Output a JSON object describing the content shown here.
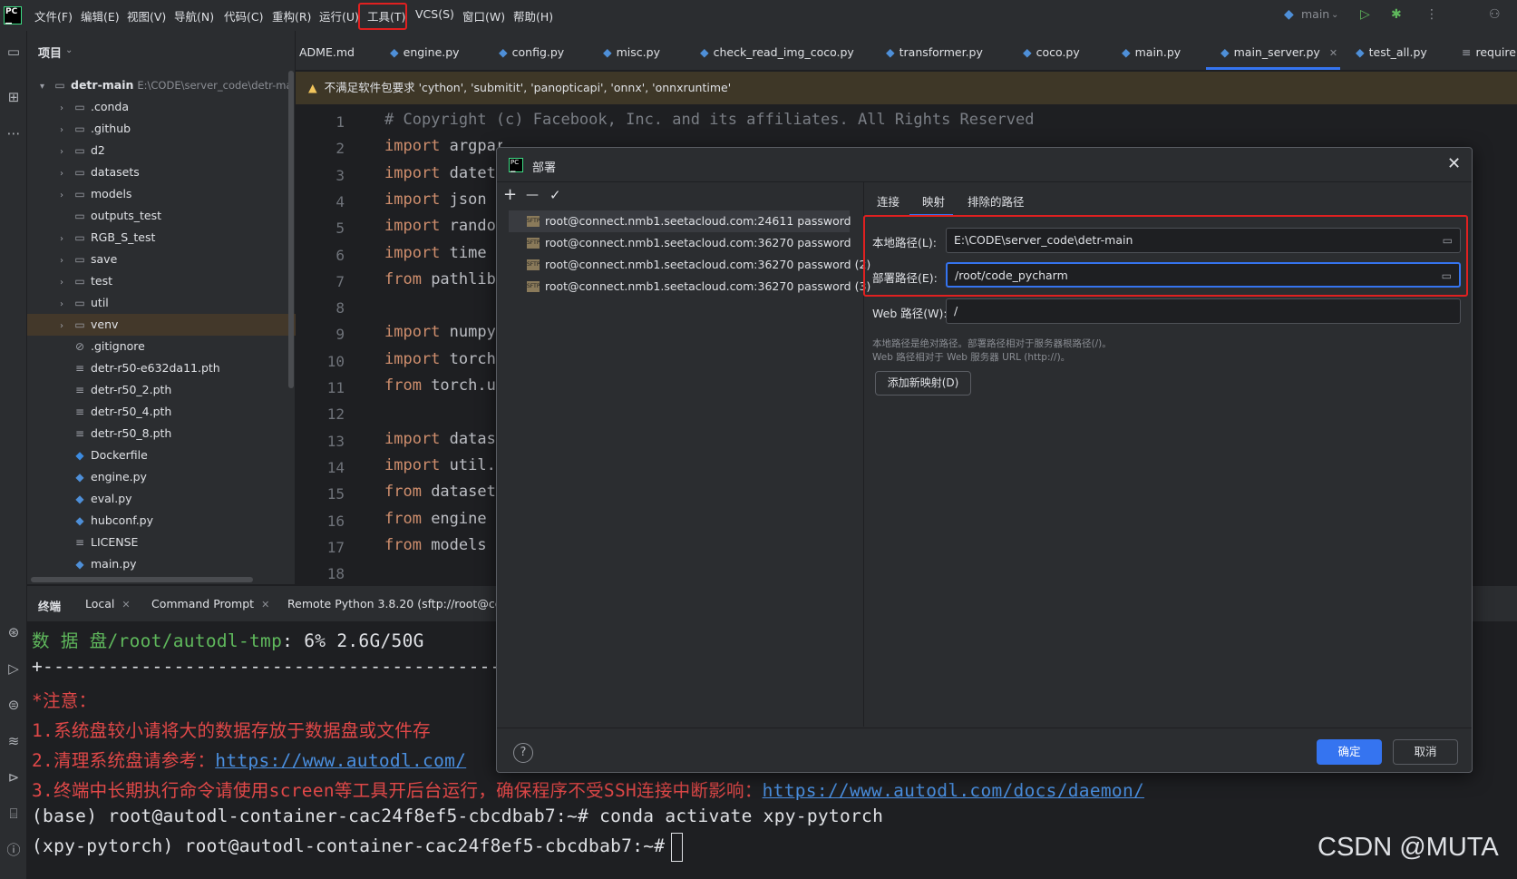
{
  "menubar": {
    "items": [
      "文件(F)",
      "编辑(E)",
      "视图(V)",
      "导航(N)",
      "代码(C)",
      "重构(R)",
      "运行(U)",
      "工具(T)",
      "VCS(S)",
      "窗口(W)",
      "帮助(H)"
    ],
    "branch": "main"
  },
  "project": {
    "title": "项目",
    "root": {
      "name": "detr-main",
      "path": "E:\\CODE\\server_code\\detr-ma"
    },
    "items": [
      ".conda",
      ".github",
      "d2",
      "datasets",
      "models",
      "outputs_test",
      "RGB_S_test",
      "save",
      "test",
      "util",
      "venv",
      ".gitignore",
      "detr-r50-e632da11.pth",
      "detr-r50_2.pth",
      "detr-r50_4.pth",
      "detr-r50_8.pth",
      "Dockerfile",
      "engine.py",
      "eval.py",
      "hubconf.py",
      "LICENSE",
      "main.py"
    ]
  },
  "tabs": [
    "ADME.md",
    "engine.py",
    "config.py",
    "misc.py",
    "check_read_img_coco.py",
    "transformer.py",
    "coco.py",
    "main.py",
    "main_server.py",
    "test_all.py",
    "require"
  ],
  "warning": "不满足软件包要求 'cython', 'submitit', 'panopticapi', 'onnx', 'onnxruntime'",
  "editor": {
    "line_numbers": [
      "1",
      "2",
      "3",
      "4",
      "5",
      "6",
      "7",
      "8",
      "9",
      "10",
      "11",
      "12",
      "13",
      "14",
      "15",
      "16",
      "17",
      "18"
    ],
    "lines": [
      {
        "kw": "",
        "rest": "# Copyright (c) Facebook, Inc. and its affiliates. All Rights Reserved"
      },
      {
        "kw": "import",
        "rest": " argparse"
      },
      {
        "kw": "import",
        "rest": " dateti"
      },
      {
        "kw": "import",
        "rest": " json"
      },
      {
        "kw": "import",
        "rest": " randon"
      },
      {
        "kw": "import",
        "rest": " time"
      },
      {
        "kw": "from",
        "rest": " pathlib"
      },
      {
        "kw": "",
        "rest": ""
      },
      {
        "kw": "import",
        "rest": " numpy"
      },
      {
        "kw": "import",
        "rest": " torch"
      },
      {
        "kw": "from",
        "rest": " torch.ut"
      },
      {
        "kw": "",
        "rest": ""
      },
      {
        "kw": "import",
        "rest": " datase"
      },
      {
        "kw": "import",
        "rest": " util.r"
      },
      {
        "kw": "from",
        "rest": " datasets"
      },
      {
        "kw": "from",
        "rest": " engine i"
      },
      {
        "kw": "from",
        "rest": " models i"
      },
      {
        "kw": "",
        "rest": ""
      }
    ]
  },
  "terminal_tabs": [
    "终端",
    "Local",
    "Command Prompt",
    "Remote Python 3.8.20 (sftp://root@conn"
  ],
  "terminal": {
    "line1_label": "数 据 盘",
    "line1_path": "/root/autodl-tmp",
    "line1_rest": ": 6% 2.6G/50G",
    "line2": "+------------------------------------------------",
    "line3": "*注意：",
    "line4": "1.系统盘较小请将大的数据存放于数据盘或文件存",
    "line5_text": "2.清理系统盘请参考：",
    "line5_link": "https://www.autodl.com/",
    "line6_text": "3.终端中长期执行命令请使用screen等工具开后台运行，确保程序不受SSH连接中断影响：",
    "line6_link": "https://www.autodl.com/docs/daemon/",
    "line7": "(base) root@autodl-container-cac24f8ef5-cbcdbab7:~# conda activate xpy-pytorch",
    "line8": "(xpy-pytorch) root@autodl-container-cac24f8ef5-cbcdbab7:~#"
  },
  "watermark": "CSDN @MUTA",
  "dialog": {
    "title": "部署",
    "toolbar": {
      "add": "+",
      "remove": "—",
      "check": "✓"
    },
    "servers": [
      "root@connect.nmb1.seetacloud.com:24611 password",
      "root@connect.nmb1.seetacloud.com:36270 password",
      "root@connect.nmb1.seetacloud.com:36270 password (2)",
      "root@connect.nmb1.seetacloud.com:36270 password (3)"
    ],
    "tabs": [
      "连接",
      "映射",
      "排除的路径"
    ],
    "local_label": "本地路径(L):",
    "local_value": "E:\\CODE\\server_code\\detr-main",
    "deploy_label": "部署路径(E):",
    "deploy_value": "/root/code_pycharm",
    "web_label": "Web 路径(W):",
    "web_value": "/",
    "hint1": "本地路径是绝对路径。部署路径相对于服务器根路径(/)。",
    "hint2": "Web 路径相对于 Web 服务器 URL (http://)。",
    "add_mapping": "添加新映射(D)",
    "help": "?",
    "ok": "确定",
    "cancel": "取消"
  }
}
